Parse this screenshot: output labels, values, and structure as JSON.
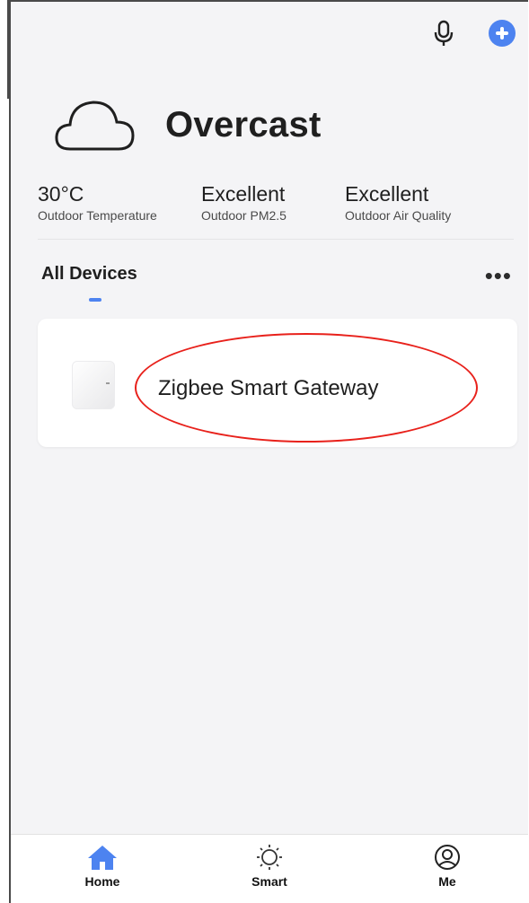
{
  "header": {
    "mic_icon": "microphone-icon",
    "add_icon": "plus-circle-icon",
    "accent_color": "#4d83f0"
  },
  "weather": {
    "icon": "cloud-icon",
    "condition": "Overcast"
  },
  "stats": [
    {
      "value": "30°C",
      "label": "Outdoor Temperature"
    },
    {
      "value": "Excellent",
      "label": "Outdoor PM2.5"
    },
    {
      "value": "Excellent",
      "label": "Outdoor Air Quality"
    }
  ],
  "devices_section": {
    "tab_label": "All Devices",
    "more_icon": "more-horizontal-icon"
  },
  "devices": [
    {
      "name": "Zigbee Smart Gateway",
      "icon": "gateway-device-icon"
    }
  ],
  "annotation": {
    "highlight_color": "#e8211b"
  },
  "tabbar": {
    "items": [
      {
        "label": "Home",
        "icon": "home-icon",
        "active": true
      },
      {
        "label": "Smart",
        "icon": "sun-icon",
        "active": false
      },
      {
        "label": "Me",
        "icon": "user-circle-icon",
        "active": false
      }
    ]
  }
}
